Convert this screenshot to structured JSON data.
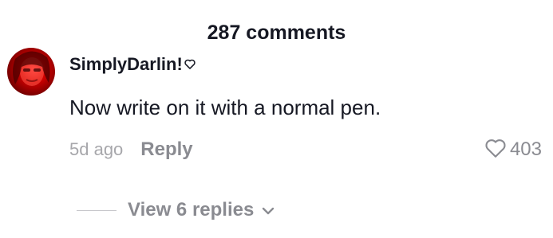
{
  "header": {
    "comment_count_label": "287 comments"
  },
  "comment": {
    "avatar_icon": "user-avatar-icon",
    "username": "SimplyDarlin!",
    "username_badge_icon": "heart-outline-icon",
    "text": "Now write on it with a normal pen.",
    "timestamp": "5d ago",
    "reply_label": "Reply",
    "like_icon": "heart-outline-icon",
    "like_count": "403"
  },
  "replies": {
    "view_label": "View 6 replies",
    "expand_icon": "chevron-down-icon"
  },
  "colors": {
    "primary_text": "#161823",
    "secondary_text": "#8a8b91",
    "timestamp_text": "#a7a7ab",
    "avatar_accent": "#d00000"
  }
}
